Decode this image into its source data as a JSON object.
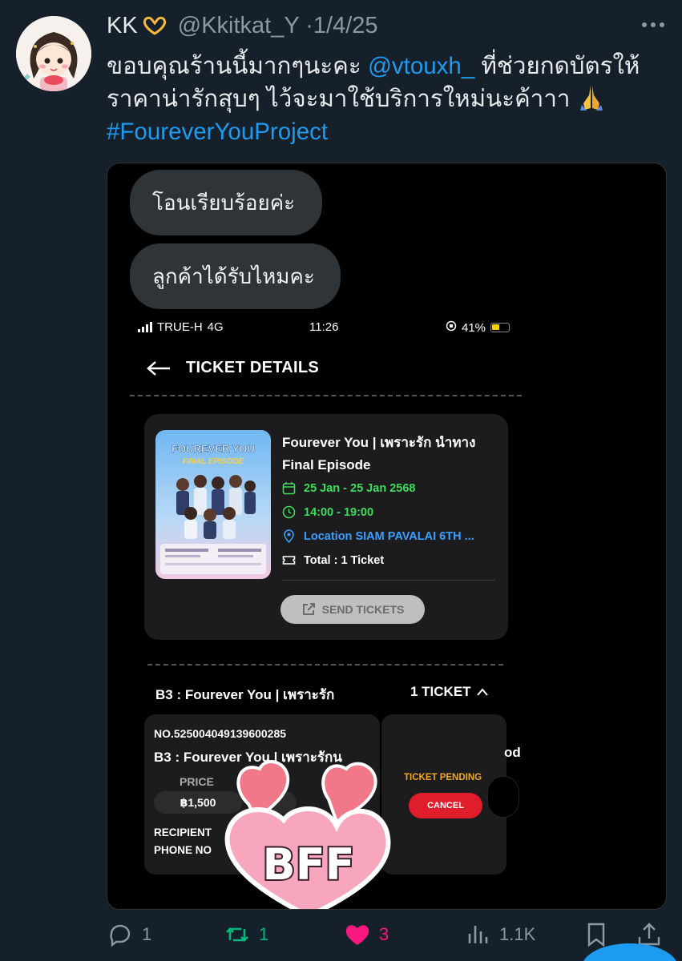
{
  "tweet": {
    "display_name": "KK",
    "handle": "@Kkitkat_Y",
    "separator": "·",
    "date": "1/4/25",
    "text_line1": "ขอบคุณร้านนี้มากๆนะคะ",
    "mention": "@vtouxh_",
    "text_line1_tail": " ที่ช่วยกดบัตรให้",
    "text_line2": "ราคาน่ารักสุบๆ ไว้จะมาใช้บริการใหม่นะค้าาา",
    "hashtag": "#FoureverYouProject"
  },
  "screenshot": {
    "chat": {
      "bubble1": "โอนเรียบร้อยค่ะ",
      "bubble2": "ลูกค้าได้รับไหมคะ"
    },
    "status_bar": {
      "carrier": "TRUE-H",
      "network": "4G",
      "time": "11:26",
      "battery": "41%"
    },
    "ticket_details": {
      "title": "TICKET DETAILS",
      "event_name": "Fourever You | เพราะรัก นำทาง Final Episode",
      "date": "25 Jan - 25 Jan 2568",
      "time": "14:00 - 19:00",
      "location": "Location SIAM PAVALAI 6TH ...",
      "total": "Total : 1 Ticket",
      "send_label": "SEND TICKETS",
      "poster_title": "FOUREVER YOU",
      "poster_subtitle": "FINAL EPISODE"
    },
    "zone": {
      "name": "B3 : Fourever You | เพราะรัก",
      "count": "1 TICKET"
    },
    "ticket": {
      "number": "NO.525004049139600285",
      "name": "B3 : Fourever You | เพราะรักน",
      "name_overflow": "od",
      "price_label": "PRICE",
      "price": "฿1,500",
      "recipient_label": "RECIPIENT",
      "phone_label": "PHONE NO",
      "status": "TICKET PENDING",
      "cancel_label": "CANCEL"
    },
    "sticker_text": "BFF"
  },
  "actions": {
    "replies": "1",
    "retweets": "1",
    "likes": "3",
    "views": "1.1K"
  },
  "colors": {
    "background": "#15202b",
    "link": "#1d9bf0",
    "retweet": "#00ba7c",
    "like": "#f91880",
    "green_detail": "#3ddc5a",
    "blue_detail": "#3aa0ff",
    "pending": "#f2a71b",
    "cancel": "#e01e2b"
  }
}
